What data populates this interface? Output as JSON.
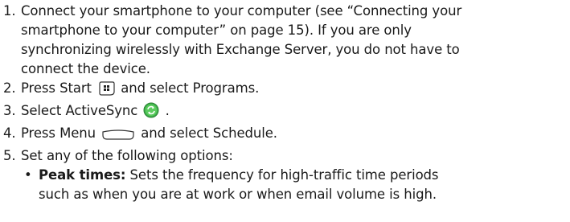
{
  "steps": [
    {
      "num": "1.",
      "lines": [
        "Connect your smartphone to your computer (see “Connecting your",
        "smartphone to your computer” on page 15). If you are only",
        "synchronizing wirelessly with Exchange Server, you do not have to",
        "connect the device."
      ]
    },
    {
      "num": "2.",
      "before": "Press Start",
      "icon": "windows-start-key-icon",
      "after": "and select Programs."
    },
    {
      "num": "3.",
      "before": "Select ActiveSync",
      "icon": "activesync-icon",
      "after": "."
    },
    {
      "num": "4.",
      "before": "Press Menu",
      "icon": "menu-softkey-icon",
      "after": "and select Schedule."
    },
    {
      "num": "5.",
      "text": "Set any of the following options:",
      "options": [
        {
          "bullet": "•",
          "term": "Peak times:",
          "desc_lines": [
            "Sets the frequency for high-traffic time periods",
            "such as when you are at work or when email volume is high."
          ]
        }
      ]
    }
  ]
}
